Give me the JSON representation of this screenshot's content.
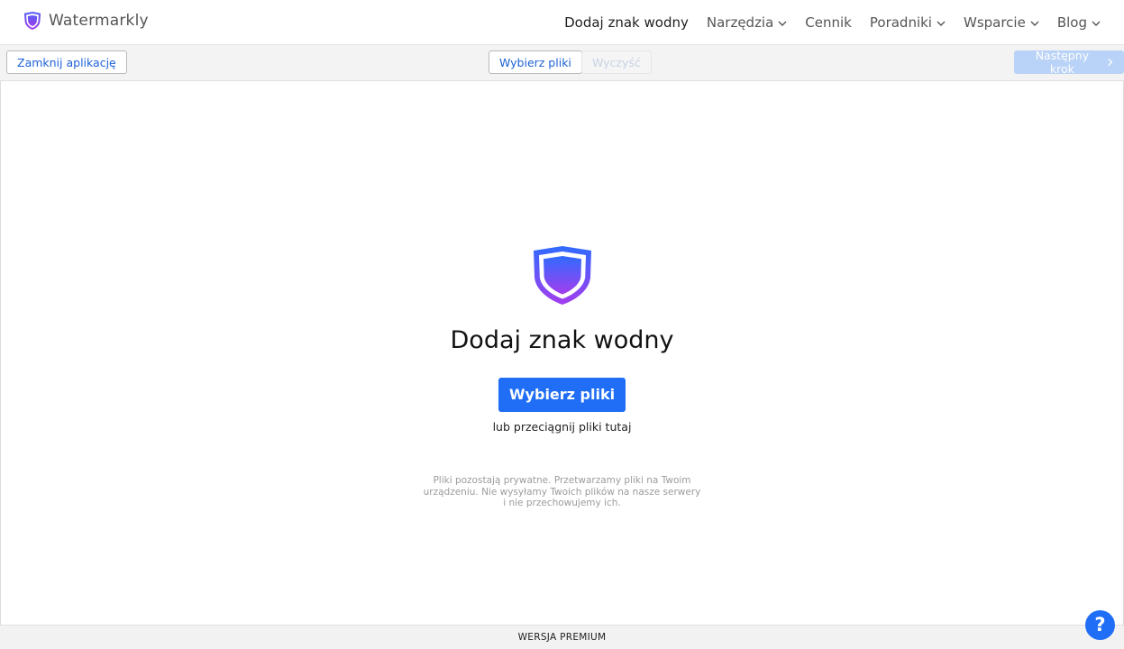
{
  "header": {
    "brand_name": "Watermarkly",
    "nav": [
      {
        "label": "Dodaj znak wodny"
      },
      {
        "label": "Narzędzia"
      },
      {
        "label": "Cennik"
      },
      {
        "label": "Poradniki"
      },
      {
        "label": "Wsparcie"
      },
      {
        "label": "Blog"
      }
    ]
  },
  "toolbar": {
    "close_label": "Zamknij aplikację",
    "choose_label": "Wybierz pliki",
    "clear_label": "Wyczyść",
    "next_label": "Następny krok"
  },
  "main": {
    "title": "Dodaj znak wodny",
    "cta_label": "Wybierz pliki",
    "drag_hint": "lub przeciągnij pliki tutaj",
    "privacy_note": "Pliki pozostają prywatne. Przetwarzamy pliki na Twoim urządzeniu. Nie wysyłamy Twoich plików na nasze serwery i nie przechowujemy ich."
  },
  "footer": {
    "label": "WERSJA PREMIUM"
  },
  "help": {
    "label": "?"
  },
  "colors": {
    "accent": "#1f6ef5",
    "logo_gradient_start": "#2f6bff",
    "logo_gradient_end": "#a43dee"
  },
  "icons": {
    "brand": "shield-logo-icon",
    "chevron": "chevron-down-icon",
    "next": "chevron-right-icon",
    "help": "question-mark-icon"
  }
}
